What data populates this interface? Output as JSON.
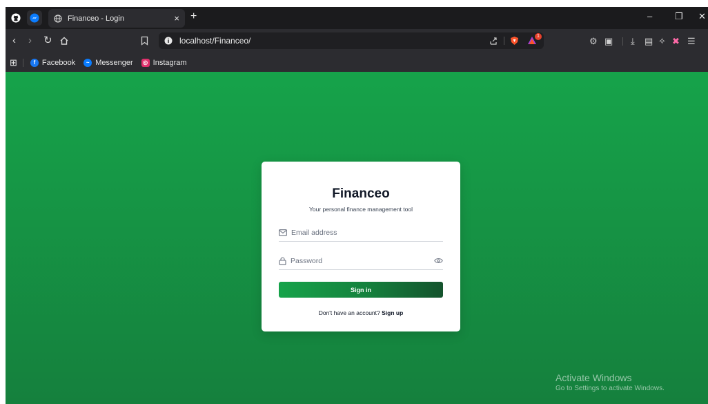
{
  "tabs": [
    {
      "title": "Financeo - Login",
      "close": "×"
    }
  ],
  "new_tab": "+",
  "window_controls": {
    "minimize": "–",
    "restore": "❐",
    "close": "✕"
  },
  "toolbar": {
    "url": "localhost/Financeo/",
    "brave_badge_count": "1"
  },
  "bookmarks": [
    {
      "label": "Facebook",
      "icon": "facebook-icon",
      "color": "#1877f2"
    },
    {
      "label": "Messenger",
      "icon": "messenger-icon",
      "color": "#0a7cff"
    },
    {
      "label": "Instagram",
      "icon": "instagram-icon",
      "color": "#e1306c"
    }
  ],
  "login": {
    "brand": "Financeo",
    "tagline": "Your personal finance management tool",
    "email_placeholder": "Email address",
    "password_placeholder": "Password",
    "signin_label": "Sign in",
    "signup_prompt": "Don't have an account?",
    "signup_link": "Sign up"
  },
  "watermark": {
    "title": "Activate Windows",
    "subtitle": "Go to Settings to activate Windows."
  },
  "colors": {
    "brand_green": "#16a34a",
    "dark_green": "#14532d"
  }
}
